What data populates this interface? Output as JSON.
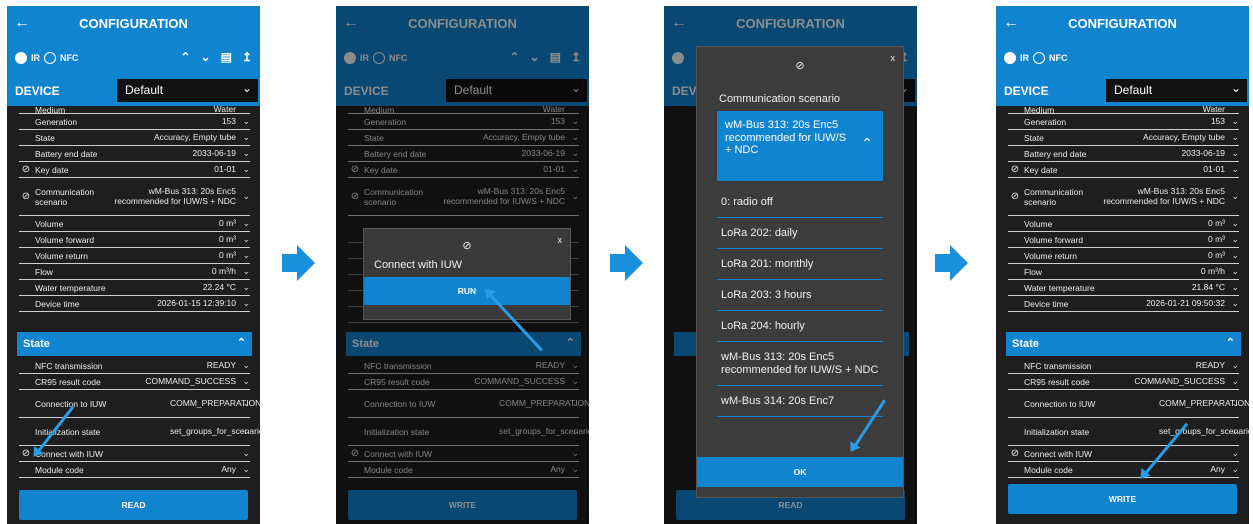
{
  "app": {
    "title": "CONFIGURATION",
    "back_icon": "arrow-left-icon"
  },
  "toggles": {
    "ir": "IR",
    "nfc": "NFC"
  },
  "device": {
    "label": "DEVICE",
    "selected": "Default"
  },
  "rows": [
    {
      "k": "Medium",
      "v": "Water"
    },
    {
      "k": "Generation",
      "v": "153"
    },
    {
      "k": "State",
      "v": "Accuracy, Empty tube"
    },
    {
      "k": "Battery end date",
      "v": "2033-06-19"
    },
    {
      "k": "Key date",
      "v": "01-01",
      "icon": true
    },
    {
      "k": "Communication scenario",
      "v": "wM-Bus 313: 20s Enc5 recommended for IUW/S + NDC",
      "icon": true,
      "tall": true
    },
    {
      "k": "Volume",
      "v": "0 m³"
    },
    {
      "k": "Volume forward",
      "v": "0 m³"
    },
    {
      "k": "Volume return",
      "v": "0 m³"
    },
    {
      "k": "Flow",
      "v": "0 m³/h"
    },
    {
      "k": "Water temperature",
      "v": "22.24 °C"
    },
    {
      "k": "Device time",
      "v": "2026-01-15 12:39:10"
    }
  ],
  "rows4_changes": {
    "water_temperature": "21.84 °C",
    "device_time": "2026-01-21 09:50:32"
  },
  "state": {
    "header": "State",
    "rows": [
      {
        "k": "NFC transmission",
        "v": "READY"
      },
      {
        "k": "CR95 result code",
        "v": "COMMAND_SUCCESS"
      },
      {
        "k": "Connection to IUW",
        "v": "COMM_PREPARATION"
      },
      {
        "k": "Initialization state",
        "v": "set_groups_for_scenario"
      },
      {
        "k": "Connect with IUW",
        "v": "",
        "icon": true
      },
      {
        "k": "Module code",
        "v": "Any"
      }
    ]
  },
  "buttons": {
    "read": "READ",
    "write": "WRITE"
  },
  "dialog_run": {
    "title": "Connect with IUW",
    "run": "RUN",
    "close": "x"
  },
  "dialog_scenario": {
    "title": "Communication scenario",
    "selected": "wM-Bus 313: 20s Enc5 recommended for IUW/S + NDC",
    "options": [
      "0: radio off",
      "LoRa 202: daily",
      "LoRa 201: monthly",
      "LoRa 203: 3 hours",
      "LoRa 204: hourly",
      "wM-Bus 313: 20s Enc5 recommended for IUW/S + NDC",
      "wM-Bus 314: 20s Enc7"
    ],
    "ok": "OK",
    "close": "x"
  },
  "colors": {
    "accent": "#1184d0",
    "panel": "#1e1e1e"
  }
}
